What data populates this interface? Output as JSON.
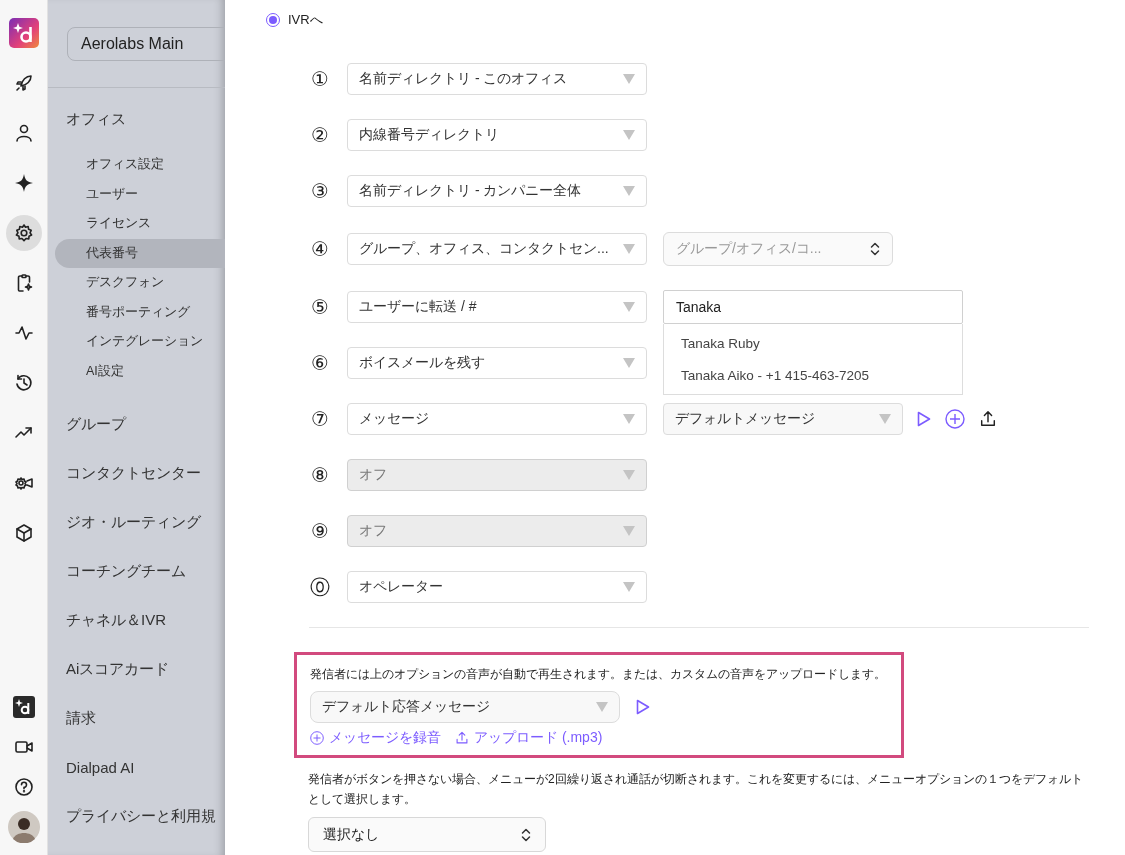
{
  "rail": {
    "top": [
      {
        "kind": "logo",
        "selected": false
      },
      {
        "kind": "rocket",
        "selected": false
      },
      {
        "kind": "person",
        "selected": false
      },
      {
        "kind": "sparkle",
        "selected": false
      },
      {
        "kind": "gear",
        "selected": true
      },
      {
        "kind": "clipboard",
        "selected": false
      },
      {
        "kind": "pulse",
        "selected": false
      },
      {
        "kind": "history",
        "selected": false
      },
      {
        "kind": "trend",
        "selected": false
      },
      {
        "kind": "camera",
        "selected": false
      },
      {
        "kind": "cube",
        "selected": false
      }
    ],
    "bottom": [
      {
        "kind": "mark",
        "selected": false
      },
      {
        "kind": "video",
        "selected": false
      },
      {
        "kind": "help",
        "selected": false
      },
      {
        "kind": "avatar",
        "selected": false
      }
    ]
  },
  "sidebar": {
    "workspace": "Aerolabs Main",
    "sections": [
      {
        "label": "オフィス",
        "selected": false,
        "children": [
          {
            "label": "オフィス設定",
            "selected": false
          },
          {
            "label": "ユーザー",
            "selected": false
          },
          {
            "label": "ライセンス",
            "selected": false
          },
          {
            "label": "代表番号",
            "selected": true
          },
          {
            "label": "デスクフォン",
            "selected": false
          },
          {
            "label": "番号ポーティング",
            "selected": false
          },
          {
            "label": "インテグレーション",
            "selected": false
          },
          {
            "label": "AI設定",
            "selected": false
          }
        ]
      },
      {
        "label": "グループ",
        "selected": false
      },
      {
        "label": "コンタクトセンター",
        "selected": false
      },
      {
        "label": "ジオ・ルーティング",
        "selected": false
      },
      {
        "label": "コーチングチーム",
        "selected": false
      },
      {
        "label": "チャネル＆IVR",
        "selected": false
      },
      {
        "label": "Aiスコアカード",
        "selected": false
      },
      {
        "label": "請求",
        "selected": false
      },
      {
        "label": "Dialpad AI",
        "selected": false
      },
      {
        "label": "プライバシーと利用規",
        "selected": false
      }
    ]
  },
  "ivr": {
    "option": {
      "label": "IVRへ",
      "selected": true
    },
    "keys": [
      {
        "key": "①",
        "action": "名前ディレクトリ - このオフィス",
        "disabled": false
      },
      {
        "key": "②",
        "action": "内線番号ディレクトリ",
        "disabled": false
      },
      {
        "key": "③",
        "action": "名前ディレクトリ - カンパニー全体",
        "disabled": false
      },
      {
        "key": "④",
        "action": "グループ、オフィス、コンタクトセン...",
        "disabled": false,
        "target": {
          "kind": "picker",
          "placeholder": "グループ/オフィス/コ..."
        }
      },
      {
        "key": "⑤",
        "action": "ユーザーに転送 / #",
        "disabled": false,
        "target": {
          "kind": "search",
          "value": "Tanaka",
          "results": [
            "Tanaka Ruby",
            "Tanaka Aiko - +1 415-463-7205"
          ]
        }
      },
      {
        "key": "⑥",
        "action": "ボイスメールを残す",
        "disabled": false
      },
      {
        "key": "⑦",
        "action": "メッセージ",
        "disabled": false,
        "target": {
          "kind": "message",
          "value": "デフォルトメッセージ"
        }
      },
      {
        "key": "⑧",
        "action": "オフ",
        "disabled": true
      },
      {
        "key": "⑨",
        "action": "オフ",
        "disabled": true
      },
      {
        "key": "⓪",
        "action": "オペレーター",
        "disabled": false
      }
    ]
  },
  "greeting": {
    "note": "発信者には上のオプションの音声が自動で再生されます。または、カスタムの音声をアップロードします。",
    "value": "デフォルト応答メッセージ",
    "links": [
      {
        "kind": "record",
        "label": "メッセージを録音"
      },
      {
        "kind": "upload",
        "label": "アップロード (.mp3)"
      }
    ]
  },
  "fallback": {
    "note": "発信者がボタンを押さない場合、メニューが2回繰り返され通話が切断されます。これを変更するには、メニューオプションの１つをデフォルトとして選択します。",
    "value": "選択なし"
  }
}
